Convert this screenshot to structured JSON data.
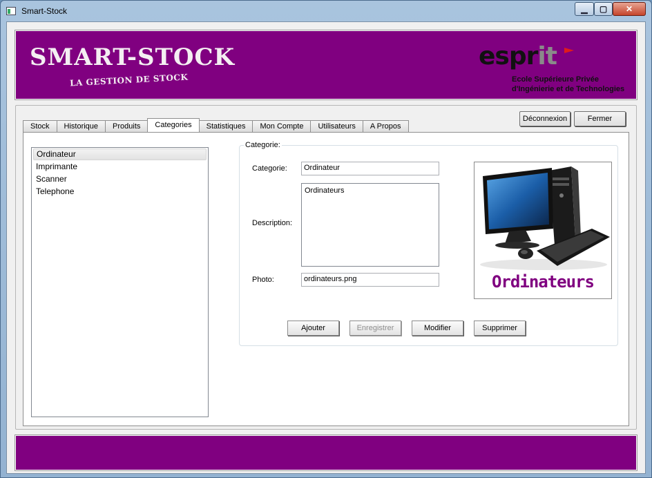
{
  "window": {
    "title": "Smart-Stock",
    "controls": {
      "minimize": "▁",
      "maximize": "▢",
      "close": "✕"
    }
  },
  "banner": {
    "logo_main": "SMART-STOCK",
    "logo_sub": "LA GESTION DE STOCK",
    "partner": {
      "word_prefix": "espr",
      "word_suffix": "it",
      "line1": "Ecole Supérieure Privée",
      "line2": "d'Ingénierie et de Technologies"
    },
    "color": "#800080"
  },
  "tabs": [
    {
      "label": "Stock",
      "active": false
    },
    {
      "label": "Historique",
      "active": false
    },
    {
      "label": "Produits",
      "active": false
    },
    {
      "label": "Categories",
      "active": true
    },
    {
      "label": "Statistiques",
      "active": false
    },
    {
      "label": "Mon Compte",
      "active": false
    },
    {
      "label": "Utilisateurs",
      "active": false
    },
    {
      "label": "A Propos",
      "active": false
    }
  ],
  "header_buttons": {
    "logout": "Déconnexion",
    "close": "Fermer"
  },
  "categories": {
    "items": [
      "Ordinateur",
      "Imprimante",
      "Scanner",
      "Telephone"
    ],
    "selected_index": 0
  },
  "form": {
    "group_title": "Categorie:",
    "category_label": "Categorie:",
    "category_value": "Ordinateur",
    "description_label": "Description:",
    "description_value": "Ordinateurs",
    "photo_label": "Photo:",
    "photo_value": "ordinateurs.png",
    "photo_caption": "Ordinateurs"
  },
  "actions": {
    "add": "Ajouter",
    "save": "Enregistrer",
    "edit": "Modifier",
    "delete": "Supprimer"
  }
}
